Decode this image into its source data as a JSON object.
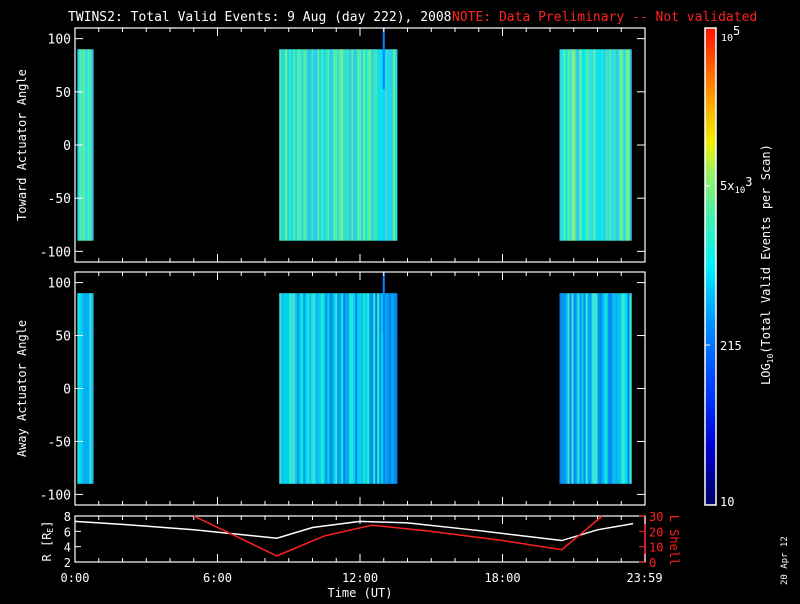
{
  "title": {
    "main": "TWINS2: Total Valid Events:  9 Aug (day 222), 2008",
    "note": "NOTE: Data Preliminary -- Not validated",
    "note_color": "#ff2020"
  },
  "date_stamp": "20 Apr 12",
  "chart_data": [
    {
      "type": "heatmap",
      "ylabel": "Toward Actuator Angle",
      "ylim": [
        -110,
        110
      ],
      "yticks": [
        "100",
        "50",
        "0",
        "-50",
        "-100"
      ],
      "ytick_values": [
        100,
        50,
        0,
        -50,
        -100
      ],
      "xlim_hours": [
        0,
        24
      ],
      "angle_range": [
        -90,
        90
      ],
      "coverage_hours": [
        [
          0.1,
          0.7
        ],
        [
          8.6,
          13.5
        ],
        [
          20.4,
          23.4
        ]
      ],
      "spike_hour": 13.0,
      "dominant_level": "approx. 215 - 5x10^3 (cyan-green)"
    },
    {
      "type": "heatmap",
      "ylabel": "Away Actuator Angle",
      "ylim": [
        -110,
        110
      ],
      "yticks": [
        "100",
        "50",
        "0",
        "-50",
        "-100"
      ],
      "ytick_values": [
        100,
        50,
        0,
        -50,
        -100
      ],
      "xlim_hours": [
        0,
        24
      ],
      "angle_range": [
        -90,
        90
      ],
      "coverage_hours": [
        [
          0.1,
          0.7
        ],
        [
          8.6,
          13.5
        ],
        [
          20.4,
          23.4
        ]
      ],
      "spike_hour": 13.0,
      "dominant_level": "approx. 215 (cyan-blue)"
    },
    {
      "type": "line",
      "xlabel": "Time (UT)",
      "xticks": [
        "0:00",
        "6:00",
        "12:00",
        "18:00",
        "23:59"
      ],
      "xtick_hours": [
        0,
        6,
        12,
        18,
        23.98
      ],
      "ylabel_left": "R [R",
      "ylabel_left_sub": "E",
      "ylabel_left_end": "]",
      "yticks_left": [
        "8",
        "6",
        "4",
        "2"
      ],
      "ylim_left": [
        2,
        8
      ],
      "ylabel_right": "L Shell",
      "yticks_right": [
        "30",
        "20",
        "10",
        "0"
      ],
      "ylim_right": [
        0,
        30
      ],
      "series": [
        {
          "name": "R",
          "color": "#ffffff",
          "x": [
            0,
            2.5,
            5,
            8.5,
            10,
            12,
            14,
            17,
            20.5,
            22,
            23.5
          ],
          "y": [
            7.3,
            6.8,
            6.2,
            5.1,
            6.5,
            7.3,
            7.1,
            6.1,
            4.8,
            6.2,
            7.0
          ]
        },
        {
          "name": "L Shell",
          "color": "#ff2020",
          "x": [
            5,
            8.5,
            10.5,
            12.5,
            15,
            18,
            20.5,
            22.2
          ],
          "y": [
            30,
            4,
            17,
            24,
            20,
            14,
            8,
            30
          ]
        }
      ]
    },
    {
      "type": "colorbar",
      "label": "LOG",
      "label_sub": "10",
      "label_rest": "(Total Valid Events per Scan)",
      "ticks": [
        {
          "base": "10",
          "exp": "5",
          "prefix": "",
          "value": 100000
        },
        {
          "prefix": "5x",
          "base": "10",
          "exp": "3",
          "value": 5000
        },
        {
          "prefix": "215",
          "base": "",
          "exp": "",
          "value": 215
        },
        {
          "prefix": "10",
          "base": "",
          "exp": "",
          "value": 10
        }
      ],
      "range": [
        10,
        100000
      ],
      "scale": "log"
    }
  ]
}
